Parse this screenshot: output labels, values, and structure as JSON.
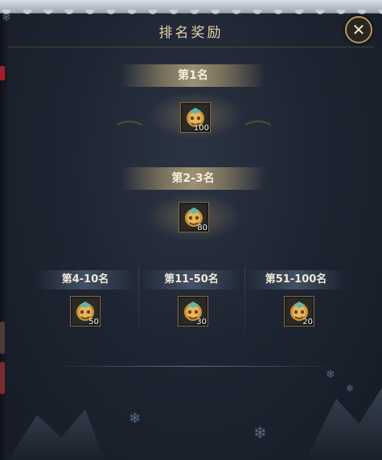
{
  "window": {
    "title": "排名奖励"
  },
  "ranks": {
    "first": {
      "label": "第1名",
      "item_name": "treasure-chest-icon",
      "quantity": "100"
    },
    "second": {
      "label": "第2-3名",
      "item_name": "treasure-chest-icon",
      "quantity": "80"
    },
    "tiers": [
      {
        "label": "第4-10名",
        "item_name": "treasure-chest-icon",
        "quantity": "50"
      },
      {
        "label": "第11-50名",
        "item_name": "treasure-chest-icon",
        "quantity": "30"
      },
      {
        "label": "第51-100名",
        "item_name": "treasure-chest-icon",
        "quantity": "20"
      }
    ]
  },
  "colors": {
    "title": "#e4d3a8",
    "frame_gold": "#b59a5a",
    "background": "#1e2532"
  },
  "icons": {
    "close": "close-icon",
    "snow": "snowflake-icon"
  }
}
